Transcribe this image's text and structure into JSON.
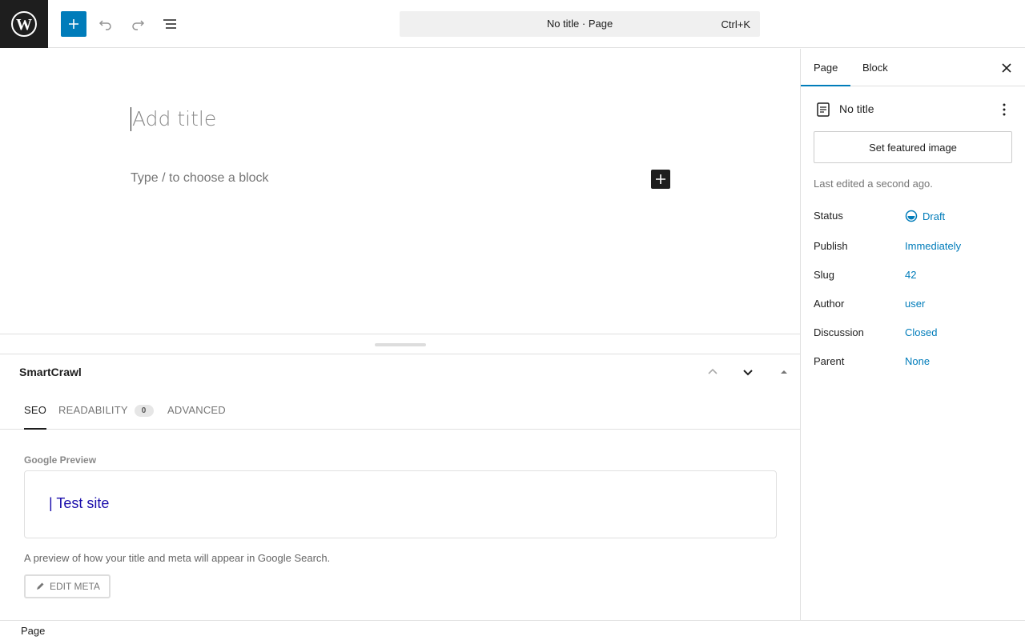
{
  "header": {
    "command_title": "No title · Page",
    "command_shortcut": "Ctrl+K",
    "icons": [
      "wordpress-logo",
      "plus-icon",
      "undo-icon",
      "redo-icon",
      "list-view-icon"
    ]
  },
  "editor": {
    "title_placeholder": "Add title",
    "block_placeholder": "Type / to choose a block"
  },
  "metabox": {
    "title": "SmartCrawl",
    "tabs": [
      {
        "label": "SEO"
      },
      {
        "label": "READABILITY",
        "badge": "0"
      },
      {
        "label": "ADVANCED"
      }
    ],
    "google_preview_label": "Google Preview",
    "preview_link": "| Test site",
    "preview_description": "A preview of how your title and meta will appear in Google Search.",
    "edit_meta_label": "EDIT META"
  },
  "footer": {
    "breadcrumb": "Page"
  },
  "sidebar": {
    "tabs": [
      "Page",
      "Block"
    ],
    "doc_title": "No title",
    "featured_image_button": "Set featured image",
    "last_edited": "Last edited a second ago.",
    "properties": [
      {
        "label": "Status",
        "value": "Draft"
      },
      {
        "label": "Publish",
        "value": "Immediately"
      },
      {
        "label": "Slug",
        "value": "42"
      },
      {
        "label": "Author",
        "value": "user"
      },
      {
        "label": "Discussion",
        "value": "Closed"
      },
      {
        "label": "Parent",
        "value": "None"
      }
    ]
  },
  "colors": {
    "accent": "#007cba",
    "dark": "#1e1e1e",
    "link": "#1a0dab"
  }
}
